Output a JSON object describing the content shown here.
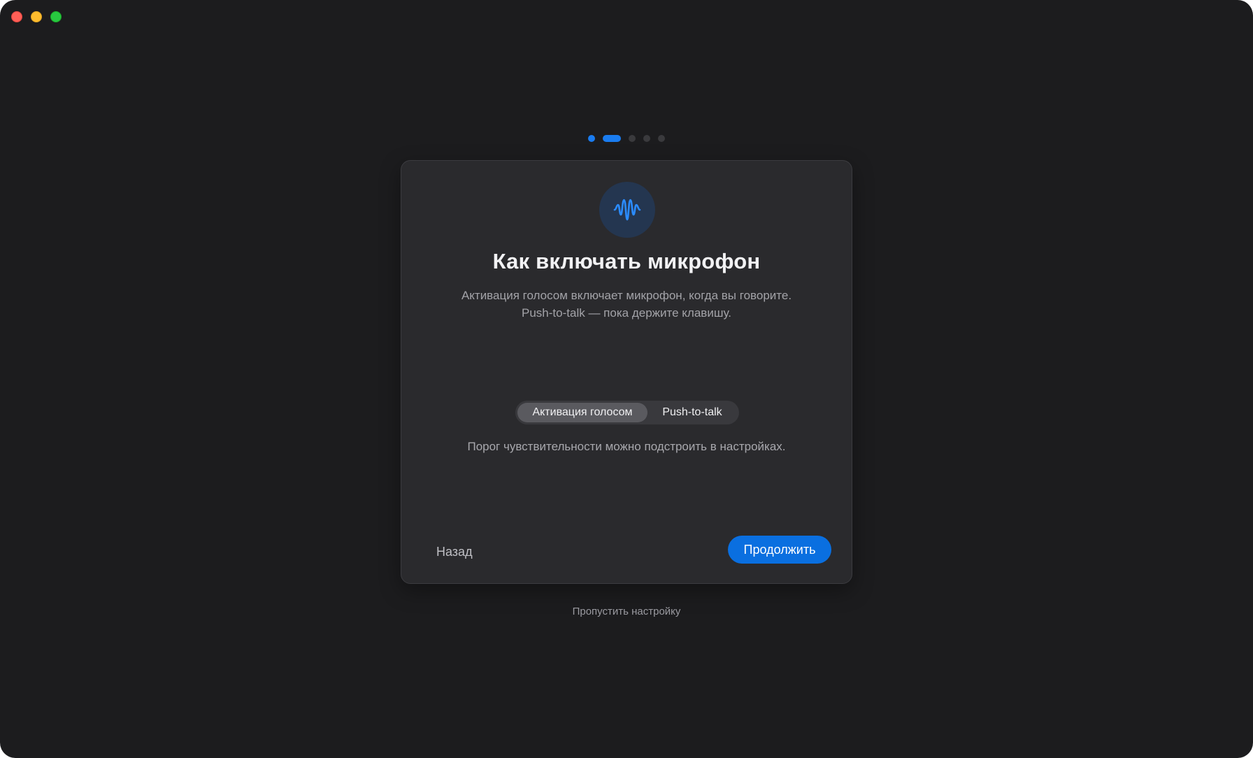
{
  "window": {
    "controls": [
      "close",
      "minimize",
      "maximize"
    ]
  },
  "progress": {
    "total_steps": 5,
    "current_step": 2
  },
  "card": {
    "icon": "waveform-icon",
    "title": "Как включать микрофон",
    "description_line1": "Активация голосом включает микрофон, когда вы говорите.",
    "description_line2": "Push-to-talk — пока держите клавишу.",
    "mode_selector": {
      "options": [
        "Активация голосом",
        "Push-to-talk"
      ],
      "selected": "Активация голосом"
    },
    "hint": "Порог чувствительности можно подстроить в настройках.",
    "back_label": "Назад",
    "continue_label": "Продолжить"
  },
  "skip_label": "Пропустить настройку",
  "colors": {
    "background": "#1c1c1e",
    "card": "#2a2a2d",
    "accent": "#0a6fe0"
  }
}
